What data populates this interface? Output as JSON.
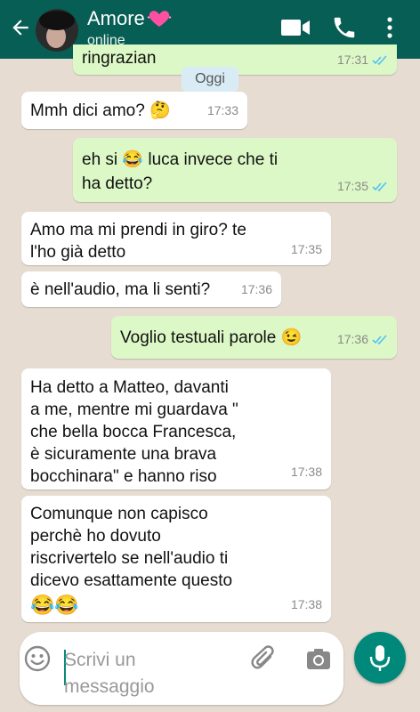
{
  "header": {
    "contact_name": "Amore",
    "status": "online",
    "icons": [
      "back-arrow-icon",
      "avatar",
      "heart-emoji-icon",
      "video-call-icon",
      "phone-icon",
      "more-menu-icon"
    ],
    "color": "#075e54"
  },
  "date_chip": "Oggi",
  "previous_message": {
    "text": "ringrazian",
    "time": "17:31"
  },
  "messages": [
    {
      "direction": "in",
      "text": "Mmh dici amo? 🤔",
      "time": "17:33"
    },
    {
      "direction": "out",
      "line1": "eh si 😂 luca invece che ti",
      "line2": "ha detto?",
      "time": "17:35",
      "read": true
    },
    {
      "direction": "in",
      "line1": "Amo ma mi prendi in giro? te",
      "line2": "l'ho già detto",
      "time": "17:35"
    },
    {
      "direction": "in",
      "text": "è nell'audio, ma li senti?",
      "time": "17:36"
    },
    {
      "direction": "out",
      "text": "Voglio testuali parole 😉",
      "time": "17:36",
      "read": true
    },
    {
      "direction": "in",
      "lines": [
        "Ha detto a Matteo, davanti",
        "a me, mentre mi guardava \"",
        "che bella bocca Francesca,",
        "è sicuramente una brava",
        "bocchinara\" e hanno riso"
      ],
      "time": "17:38"
    },
    {
      "direction": "in",
      "lines": [
        "Comunque non capisco",
        "perchè ho dovuto",
        "riscrivertelo se nell'audio ti",
        "dicevo esattamente questo",
        "😂😂"
      ],
      "time": "17:38"
    }
  ],
  "input": {
    "placeholder_line1": "Scrivi un",
    "placeholder_line2": "messaggio",
    "icons": [
      "emoji-icon",
      "attach-icon",
      "camera-icon",
      "mic-icon"
    ]
  },
  "colors": {
    "outgoing_bubble": "#dcf8c6",
    "incoming_bubble": "#ffffff",
    "read_ticks": "#4fc3f7",
    "mic_button": "#00897b"
  }
}
